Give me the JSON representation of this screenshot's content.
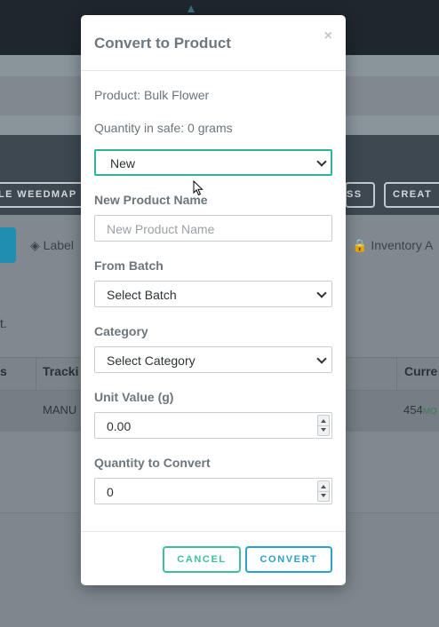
{
  "background": {
    "buttons": {
      "left_partial": "LE WEEDMAP",
      "mid_partial": "SS",
      "right_partial": "CREAT"
    },
    "tabs": {
      "labels": "Label",
      "inventory": "Inventory A"
    },
    "text_fragment": "t.",
    "table": {
      "headers": [
        "s",
        "Tracki",
        "Curre"
      ],
      "row": {
        "tracking": "MANU",
        "current_value": "454",
        "current_unit": "MO"
      }
    }
  },
  "modal": {
    "title": "Convert to Product",
    "close_glyph": "×",
    "product_info": "Product: Bulk Flower",
    "quantity_info": "Quantity in safe: 0 grams",
    "mode_select": {
      "value": "New"
    },
    "new_product_name": {
      "label": "New Product Name",
      "placeholder": "New Product Name"
    },
    "from_batch": {
      "label": "From Batch",
      "value": "Select Batch"
    },
    "category": {
      "label": "Category",
      "value": "Select Category"
    },
    "unit_value": {
      "label": "Unit Value (g)",
      "value": "0.00"
    },
    "quantity_to_convert": {
      "label": "Quantity to Convert",
      "value": "0"
    },
    "buttons": {
      "cancel": "CANCEL",
      "convert": "CONVERT"
    }
  },
  "colors": {
    "accent_green": "#3fbf9f",
    "accent_blue": "#2aa0cf",
    "focus_border": "#2fb39a"
  }
}
